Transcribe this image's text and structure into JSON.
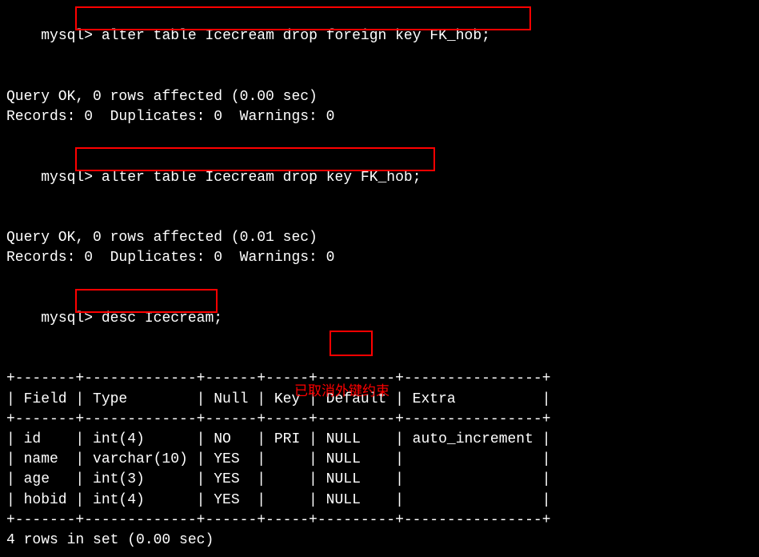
{
  "prompt": "mysql>",
  "commands": {
    "cmd1": "alter table Icecream drop foreign key FK_hob;",
    "cmd2": "alter table Icecream drop key FK_hob;",
    "cmd3": "desc Icecream;"
  },
  "results": {
    "query_ok_1": "Query OK, 0 rows affected (0.00 sec)",
    "records_1": "Records: 0  Duplicates: 0  Warnings: 0",
    "query_ok_2": "Query OK, 0 rows affected (0.01 sec)",
    "records_2": "Records: 0  Duplicates: 0  Warnings: 0",
    "footer": "4 rows in set (0.00 sec)"
  },
  "table": {
    "border_top": "+-------+-------------+------+-----+---------+----------------+",
    "header": "| Field | Type        | Null | Key | Default | Extra          |",
    "border_mid": "+-------+-------------+------+-----+---------+----------------+",
    "rows": [
      "| id    | int(4)      | NO   | PRI | NULL    | auto_increment |",
      "| name  | varchar(10) | YES  |     | NULL    |                |",
      "| age   | int(3)      | YES  |     | NULL    |                |",
      "| hobid | int(4)      | YES  |     | NULL    |                |"
    ],
    "border_bot": "+-------+-------------+------+-----+---------+----------------+"
  },
  "annotation": "已取消外键约束",
  "chart_data": {
    "type": "table",
    "title": "desc Icecream",
    "columns": [
      "Field",
      "Type",
      "Null",
      "Key",
      "Default",
      "Extra"
    ],
    "rows": [
      {
        "Field": "id",
        "Type": "int(4)",
        "Null": "NO",
        "Key": "PRI",
        "Default": "NULL",
        "Extra": "auto_increment"
      },
      {
        "Field": "name",
        "Type": "varchar(10)",
        "Null": "YES",
        "Key": "",
        "Default": "NULL",
        "Extra": ""
      },
      {
        "Field": "age",
        "Type": "int(3)",
        "Null": "YES",
        "Key": "",
        "Default": "NULL",
        "Extra": ""
      },
      {
        "Field": "hobid",
        "Type": "int(4)",
        "Null": "YES",
        "Key": "",
        "Default": "NULL",
        "Extra": ""
      }
    ]
  }
}
